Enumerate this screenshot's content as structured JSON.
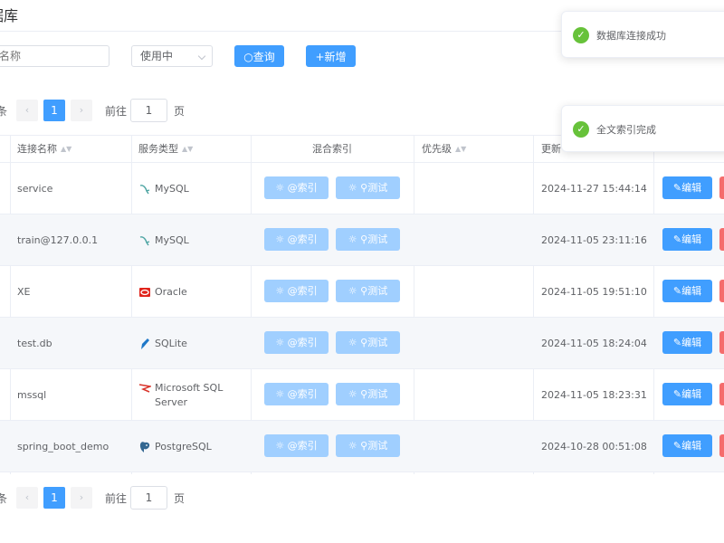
{
  "page": {
    "title": "据库"
  },
  "filters": {
    "name_placeholder": "名称",
    "status_value": "使用中",
    "query_label": "查询",
    "add_label": "新增"
  },
  "pagination": {
    "edge_text": "条",
    "current_page": "1",
    "goto_label": "前往",
    "goto_value": "1",
    "page_word": "页"
  },
  "table": {
    "headers": {
      "name": "连接名称",
      "type": "服务类型",
      "hybrid_index": "混合索引",
      "priority": "优先级",
      "updated": "更新",
      "actions": ""
    },
    "row_buttons": {
      "index": "索引",
      "test": "测试",
      "edit": "编辑"
    },
    "rows": [
      {
        "name": "service",
        "type": "MySQL",
        "updated": "2024-11-27 15:44:14"
      },
      {
        "name": "train@127.0.0.1",
        "type": "MySQL",
        "updated": "2024-11-05 23:11:16"
      },
      {
        "name": "XE",
        "type": "Oracle",
        "updated": "2024-11-05 19:51:10"
      },
      {
        "name": "test.db",
        "type": "SQLite",
        "updated": "2024-11-05 18:24:04"
      },
      {
        "name": "mssql",
        "type": "Microsoft SQL Server",
        "updated": "2024-11-05 18:23:31"
      },
      {
        "name": "spring_boot_demo",
        "type": "PostgreSQL",
        "updated": "2024-10-28 00:51:08"
      }
    ]
  },
  "toasts": [
    {
      "message": "数据库连接成功"
    },
    {
      "message": "全文索引完成"
    }
  ],
  "colors": {
    "primary": "#409eff",
    "primary_light": "#a0cfff",
    "danger": "#f56c6c",
    "success": "#67c23a",
    "oracle": "#e0231b",
    "sqlite": "#1f78c8",
    "mssql": "#d9342b",
    "postgres": "#336791",
    "mysql": "#4aa3a1"
  },
  "icons": {
    "mysql": "mysql-dolphin-icon",
    "oracle": "oracle-logo-icon",
    "sqlite": "sqlite-feather-icon",
    "mssql": "sql-server-icon",
    "postgres": "postgresql-elephant-icon",
    "search": "search-icon",
    "plus": "plus-icon",
    "success": "check-circle-icon"
  }
}
